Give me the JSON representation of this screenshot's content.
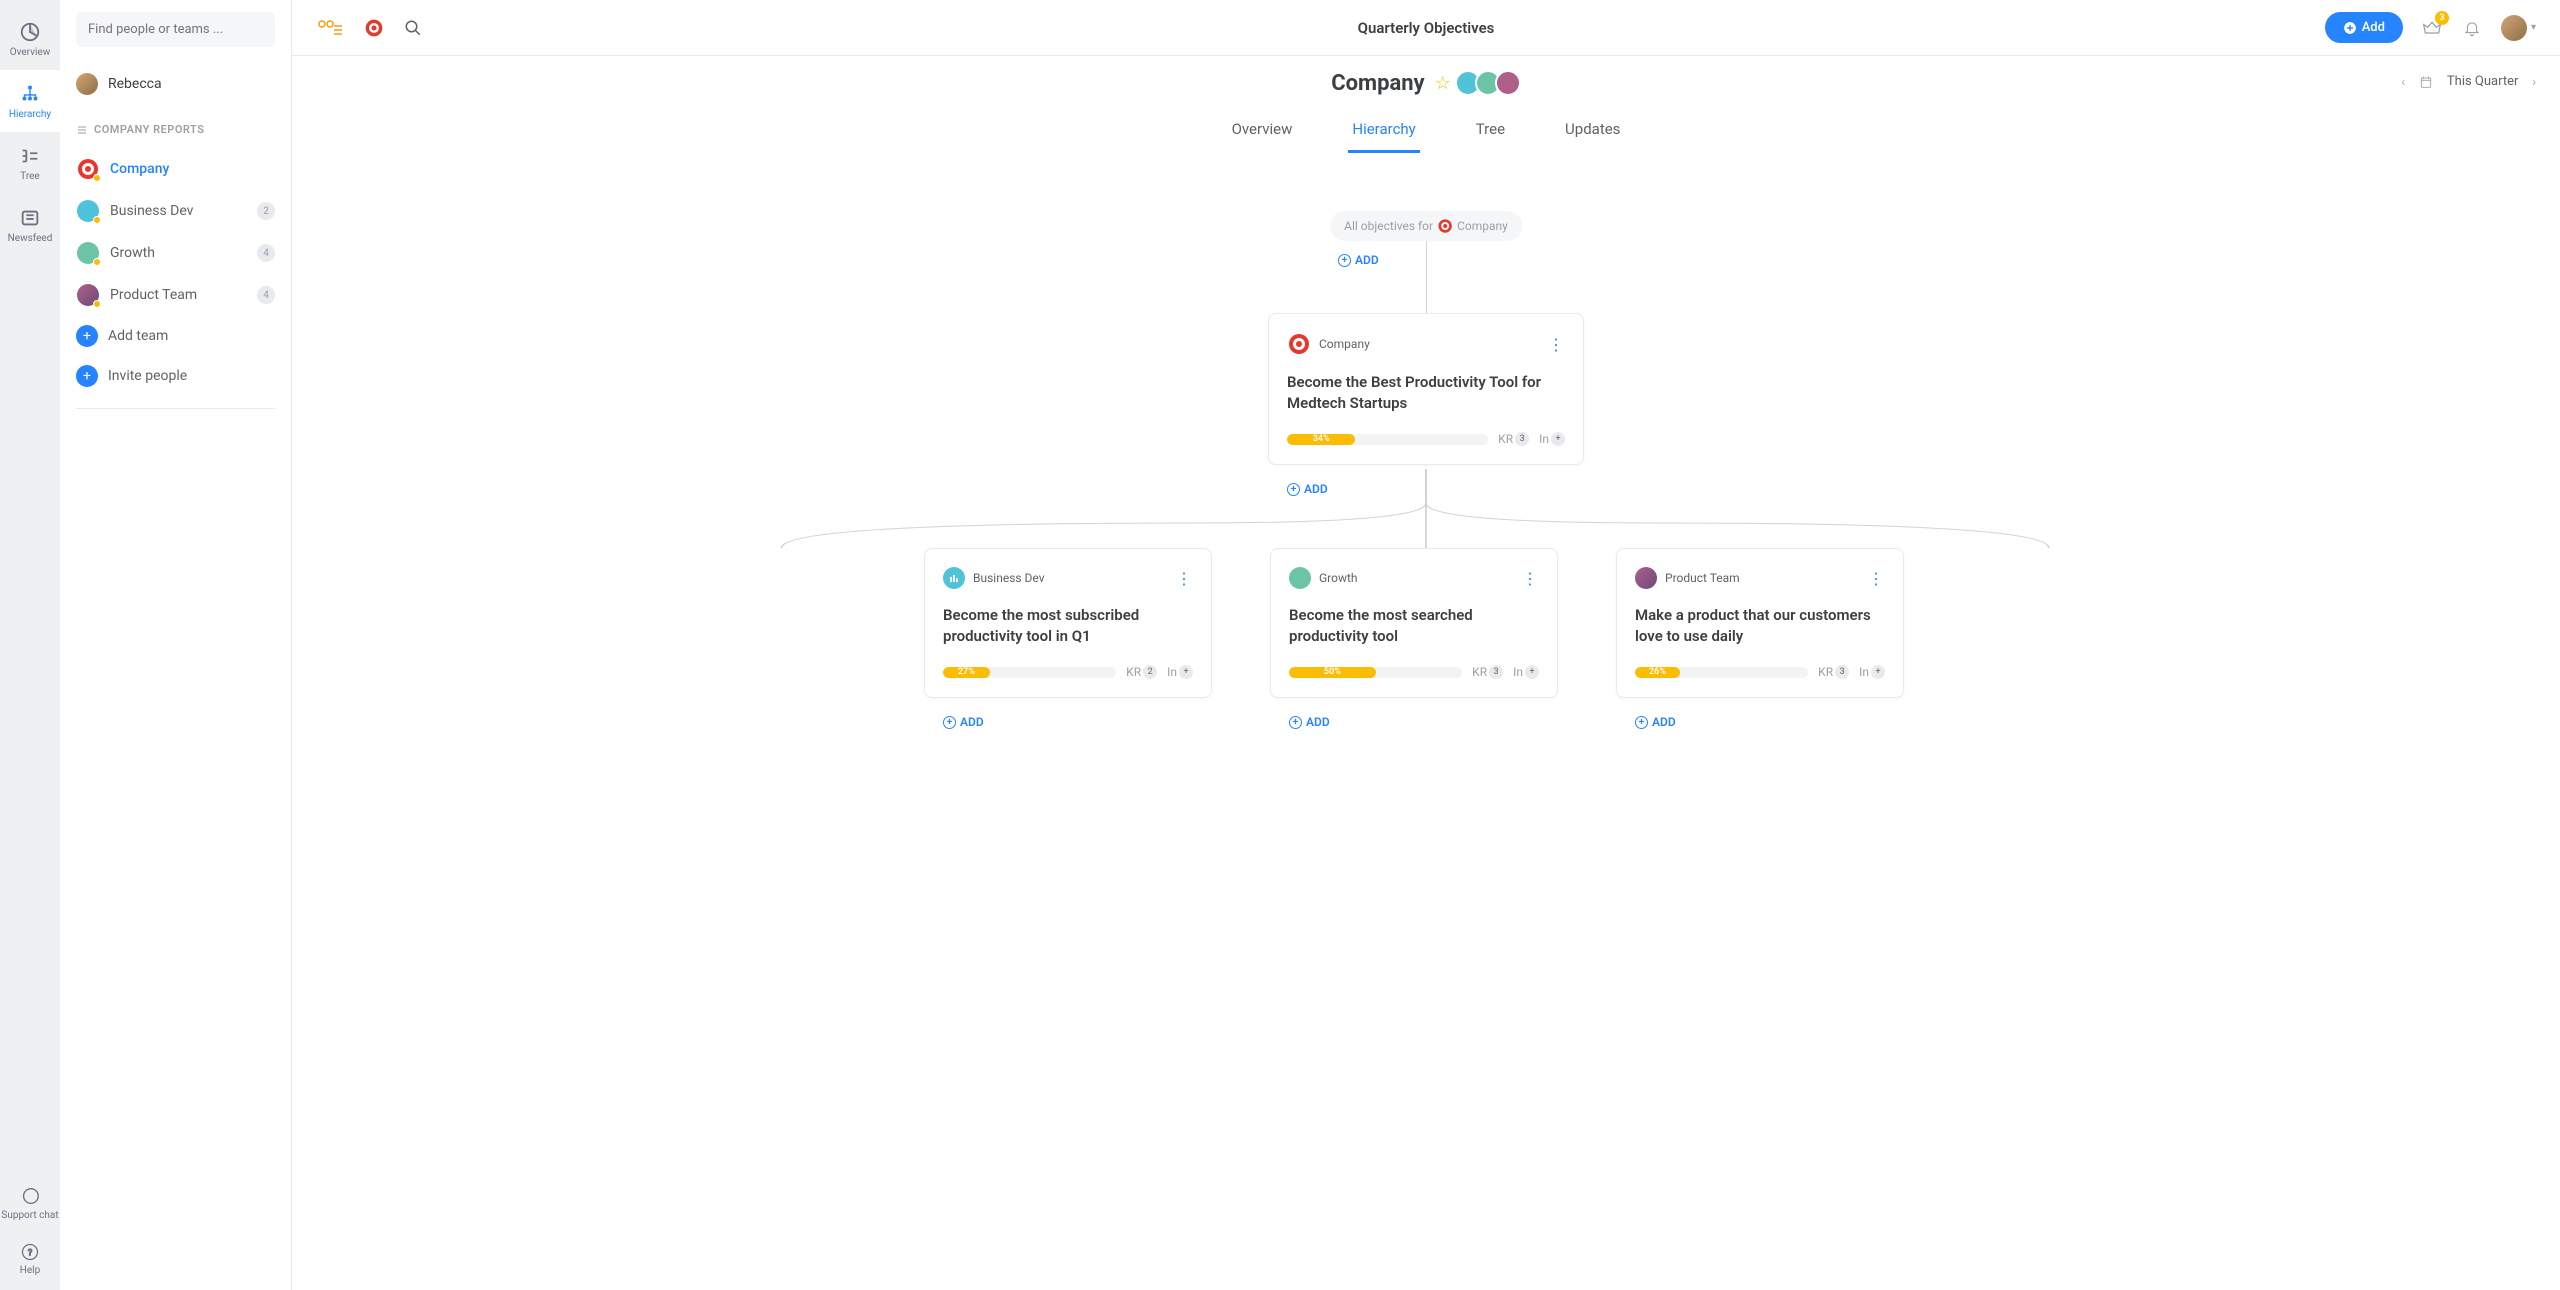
{
  "nav_rail": {
    "items": [
      {
        "label": "Overview"
      },
      {
        "label": "Hierarchy"
      },
      {
        "label": "Tree"
      },
      {
        "label": "Newsfeed"
      }
    ],
    "bottom": [
      {
        "label": "Support chat"
      },
      {
        "label": "Help"
      }
    ]
  },
  "sidebar": {
    "search_placeholder": "Find people or teams ...",
    "user_name": "Rebecca",
    "section_title": "COMPANY REPORTS",
    "reports": [
      {
        "label": "Company",
        "active": true,
        "count": null
      },
      {
        "label": "Business Dev",
        "active": false,
        "count": "2"
      },
      {
        "label": "Growth",
        "active": false,
        "count": "4"
      },
      {
        "label": "Product Team",
        "active": false,
        "count": "4"
      }
    ],
    "add_team": "Add team",
    "invite_people": "Invite people"
  },
  "topbar": {
    "title": "Quarterly Objectives",
    "add_label": "Add",
    "crown_badge": "3"
  },
  "page": {
    "title": "Company",
    "period_label": "This Quarter",
    "tabs": [
      {
        "label": "Overview",
        "active": false
      },
      {
        "label": "Hierarchy",
        "active": true
      },
      {
        "label": "Tree",
        "active": false
      },
      {
        "label": "Updates",
        "active": false
      }
    ]
  },
  "canvas": {
    "root_chip_prefix": "All objectives for",
    "root_chip_suffix": "Company",
    "add_label": "ADD",
    "main_card": {
      "team": "Company",
      "title": "Become the Best Productivity Tool for Medtech Startups",
      "progress": "34%",
      "kr_label": "KR",
      "kr_count": "3",
      "in_label": "In",
      "in_count": "+"
    },
    "children": [
      {
        "team": "Business Dev",
        "title": "Become the most subscribed productivity tool in Q1",
        "progress": "27%",
        "kr_label": "KR",
        "kr_count": "2",
        "in_label": "In",
        "in_count": "+"
      },
      {
        "team": "Growth",
        "title": "Become the most searched productivity tool",
        "progress": "50%",
        "kr_label": "KR",
        "kr_count": "3",
        "in_label": "In",
        "in_count": "+"
      },
      {
        "team": "Product Team",
        "title": "Make a product that our customers love to use daily",
        "progress": "26%",
        "kr_label": "KR",
        "kr_count": "3",
        "in_label": "In",
        "in_count": "+"
      }
    ]
  }
}
